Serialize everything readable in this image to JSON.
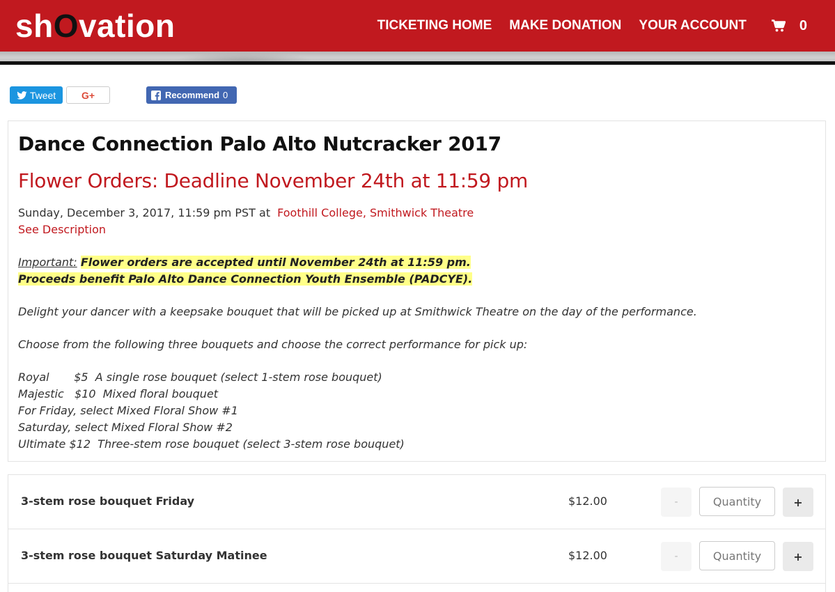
{
  "brand": {
    "logo_prefix": "sh",
    "logo_o": "O",
    "logo_suffix": "vation",
    "primary_color": "#c1191f"
  },
  "nav": {
    "items": [
      "TICKETING HOME",
      "MAKE DONATION",
      "YOUR ACCOUNT"
    ],
    "cart_count": "0",
    "cart_icon": "shopping-cart-icon"
  },
  "social": {
    "tweet_label": "Tweet",
    "gplus_label": "G+",
    "fb_label": "Recommend",
    "fb_count": "0"
  },
  "event": {
    "title": "Dance Connection Palo Alto Nutcracker 2017",
    "subtitle": "Flower Orders: Deadline November 24th at 11:59 pm",
    "date": "Sunday, December 3, 2017, 11:59 pm PST at",
    "venue": "Foothill College, Smithwick Theatre",
    "see_description": "See Description"
  },
  "description": {
    "important_label": "Important:",
    "highlight_1": "Flower orders are accepted until November 24th at 11:59 pm.",
    "highlight_2": "Proceeds benefit Palo Alto Dance Connection Youth Ensemble (PADCYE).",
    "paragraph_1": "Delight your dancer with a keepsake bouquet that will be picked up at Smithwick Theatre on the day of the performance.",
    "paragraph_2": "Choose from the following three bouquets and choose the correct performance for pick up:",
    "options": [
      "Royal       $5  A single rose bouquet (select 1-stem rose bouquet)",
      "Majestic   $10  Mixed floral bouquet",
      "For Friday, select Mixed Floral Show #1",
      "Saturday, select Mixed Floral Show #2",
      "Ultimate $12  Three-stem rose bouquet (select 3-stem rose bouquet)"
    ]
  },
  "products": [
    {
      "name": "3-stem rose bouquet Friday",
      "price": "$12.00",
      "quantity_placeholder": "Quantity",
      "minus_label": "-",
      "plus_label": "+"
    },
    {
      "name": "3-stem rose bouquet Saturday Matinee",
      "price": "$12.00",
      "quantity_placeholder": "Quantity",
      "minus_label": "-",
      "plus_label": "+"
    }
  ]
}
